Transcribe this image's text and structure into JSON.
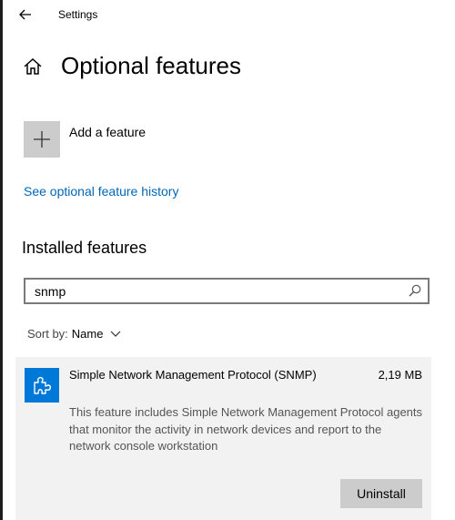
{
  "window": {
    "title": "Settings",
    "back_icon": "arrow-left-icon"
  },
  "page": {
    "title": "Optional features",
    "home_icon": "home-icon"
  },
  "add_feature": {
    "label": "Add a feature",
    "icon": "plus-icon"
  },
  "history_link": {
    "label": "See optional feature history"
  },
  "installed": {
    "title": "Installed features"
  },
  "search": {
    "value": "snmp",
    "placeholder": "",
    "icon": "search-icon"
  },
  "sort": {
    "label": "Sort by:",
    "value": "Name",
    "icon": "chevron-down-icon"
  },
  "features": [
    {
      "name": "Simple Network Management Protocol (SNMP)",
      "size": "2,19 MB",
      "description": "This feature includes Simple Network Management Protocol agents that monitor the activity in network devices and report to the network console workstation",
      "action_label": "Uninstall",
      "icon": "puzzle-piece-icon"
    }
  ],
  "colors": {
    "accent": "#0078d7",
    "link": "#0067b8",
    "card_background": "#f2f2f2",
    "button_background": "#cccccc"
  }
}
